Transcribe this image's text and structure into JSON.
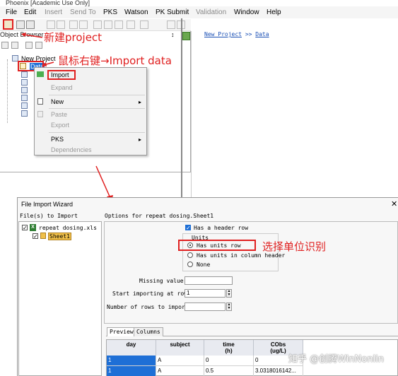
{
  "window": {
    "title": "Phoenix [Academic Use Only]"
  },
  "menubar": {
    "items": [
      "File",
      "Edit",
      "Insert",
      "Send To",
      "PKS",
      "Watson",
      "PK Submit",
      "Validation",
      "Window",
      "Help"
    ]
  },
  "object_browser": {
    "header": "Object Browser",
    "pin": "↕",
    "tree": {
      "project": "New Project",
      "data": "Data"
    }
  },
  "breadcrumb": {
    "project": "New Project",
    "separator": ">>",
    "current": "Data"
  },
  "context_menu": {
    "items": [
      {
        "label": "Import",
        "enabled": true
      },
      {
        "label": "Expand",
        "enabled": false
      },
      {
        "label": "New",
        "enabled": true,
        "submenu": true
      },
      {
        "label": "Paste",
        "enabled": false
      },
      {
        "label": "Export",
        "enabled": false
      },
      {
        "label": "PKS",
        "enabled": true,
        "submenu": true
      },
      {
        "label": "Dependencies",
        "enabled": false
      }
    ],
    "submenu_glyph": "▸"
  },
  "annotations": {
    "new_project": "新建project",
    "import_data": "鼠标右键→Import data",
    "select_units": "选择单位识别"
  },
  "wizard": {
    "title": "File Import Wizard",
    "close_glyph": "✕",
    "files_label": "File(s) to Import",
    "file_name": "repeat dosing.xls",
    "sheet_name": "Sheet1",
    "options_title": "Options for repeat dosing.Sheet1",
    "has_header_row": "Has a header row",
    "units_group_label": "Units",
    "units_options": [
      "Has units row",
      "Has units in column header",
      "None"
    ],
    "units_selected": 0,
    "missing_value_label": "Missing value:",
    "missing_value": "",
    "start_row_label": "Start importing at row:",
    "start_row": "1",
    "num_rows_label": "Number of rows to import:",
    "num_rows": "",
    "tabs": [
      "Preview",
      "Columns"
    ],
    "active_tab": 0,
    "grid": {
      "columns": [
        {
          "name": "day",
          "unit": ""
        },
        {
          "name": "subject",
          "unit": ""
        },
        {
          "name": "time",
          "unit": "(h)"
        },
        {
          "name": "CObs",
          "unit": "(ug/L)"
        }
      ],
      "rows": [
        [
          "1",
          "A",
          "0",
          "0"
        ],
        [
          "1",
          "A",
          "0.5",
          "3.0318016142..."
        ]
      ]
    }
  },
  "watermark": "知乎 @创腾WinNonlin",
  "colors": {
    "annotation_red": "#e02020",
    "selection_blue": "#1e6fd6",
    "link_blue": "#1a4fb5"
  }
}
